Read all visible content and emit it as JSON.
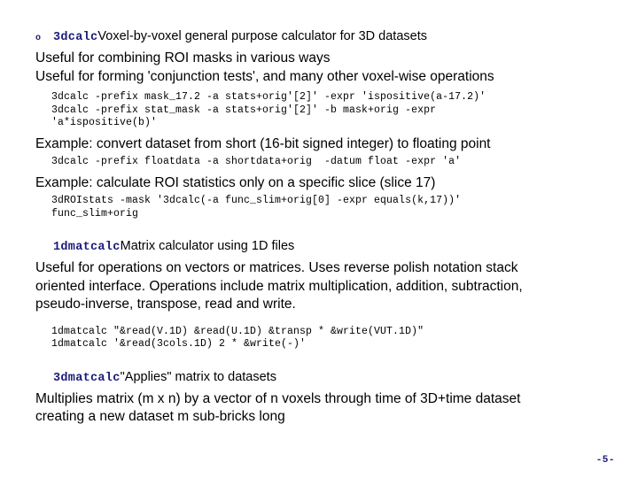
{
  "slide": {
    "page_marker": "-5-",
    "accent_color": "#1a1a7a",
    "sections": [
      {
        "bullet": "o",
        "term": "3dcalc",
        "term_description": "Voxel-by-voxel general purpose calculator for 3D datasets",
        "prose": [
          "Useful for combining ROI masks in various ways",
          "Useful for forming 'conjunction tests', and many other voxel-wise operations"
        ],
        "code_block_1": "3dcalc -prefix mask_17.2 -a stats+orig'[2]' -expr 'ispositive(a-17.2)'\n3dcalc -prefix stat_mask -a stats+orig'[2]' -b mask+orig -expr\n'a*ispositive(b)'",
        "example_1_label": "Example: convert dataset from short (16-bit signed integer) to floating point",
        "example_1_code": "3dcalc -prefix floatdata -a shortdata+orig  -datum float -expr 'a'",
        "example_2_label": "Example: calculate ROI statistics only on a specific slice (slice 17)",
        "example_2_code": "3dROIstats -mask '3dcalc(-a func_slim+orig[0] -expr equals(k,17))'\nfunc_slim+orig"
      },
      {
        "term": "1dmatcalc",
        "term_description": "Matrix calculator using 1D files",
        "prose_first": "Useful for operations on vectors or matrices. Uses reverse polish notation stack",
        "prose_wrapped": [
          "oriented interface. Operations include matrix multiplication, addition, subtraction,",
          "pseudo-inverse, transpose, read and write."
        ],
        "code_block": "1dmatcalc \"&read(V.1D) &read(U.1D) &transp * &write(VUT.1D)\"\n1dmatcalc '&read(3cols.1D) 2 * &write(-)'"
      },
      {
        "term": "3dmatcalc",
        "term_description": "\"Applies\" matrix to datasets",
        "prose_first": "Multiplies matrix (m x n) by a vector of n voxels through time of 3D+time dataset",
        "prose_wrapped": [
          "creating a new dataset m sub-bricks long"
        ]
      }
    ]
  }
}
